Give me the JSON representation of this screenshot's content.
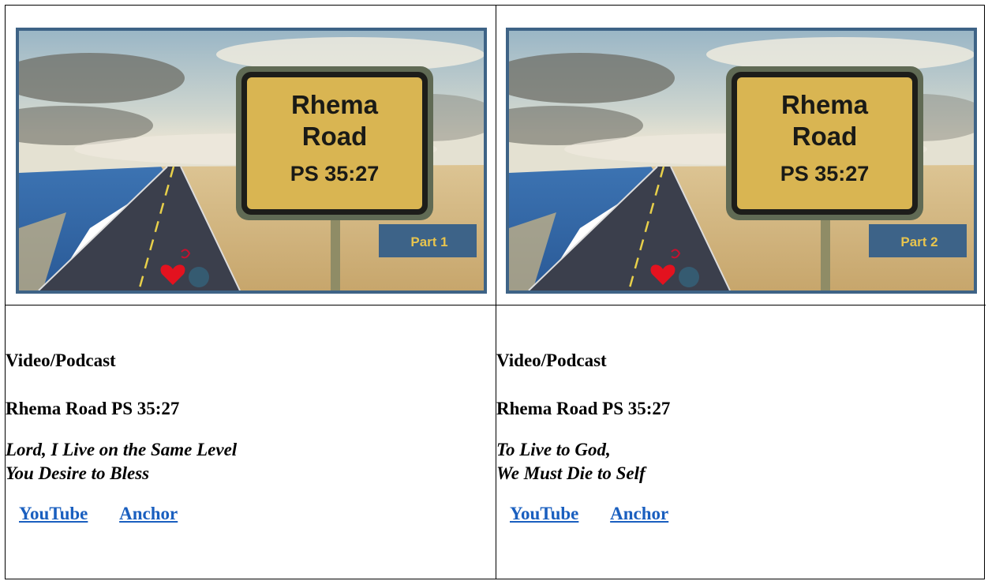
{
  "colors": {
    "thumb_border": "#3e6386",
    "sign_fill": "#d9b552",
    "part_box": "#3d6388",
    "link": "#1a5fbf"
  },
  "cards": [
    {
      "thumbnail": {
        "sign_line1": "Rhema",
        "sign_line2": "Road",
        "sign_line3": "PS 35:27",
        "part_label": "Part 1"
      },
      "kind": "Video/Podcast",
      "title": "Rhema Road PS 35:27",
      "subtitle_line1": "Lord, I Live on the Same Level",
      "subtitle_line2": "You Desire to Bless",
      "link_youtube": "YouTube",
      "link_anchor": "Anchor"
    },
    {
      "thumbnail": {
        "sign_line1": "Rhema",
        "sign_line2": "Road",
        "sign_line3": "PS 35:27",
        "part_label": "Part 2"
      },
      "kind": "Video/Podcast",
      "title": "Rhema Road PS 35:27",
      "subtitle_line1": "To Live to God,",
      "subtitle_line2": "We Must Die to Self",
      "link_youtube": "YouTube",
      "link_anchor": "Anchor"
    }
  ]
}
